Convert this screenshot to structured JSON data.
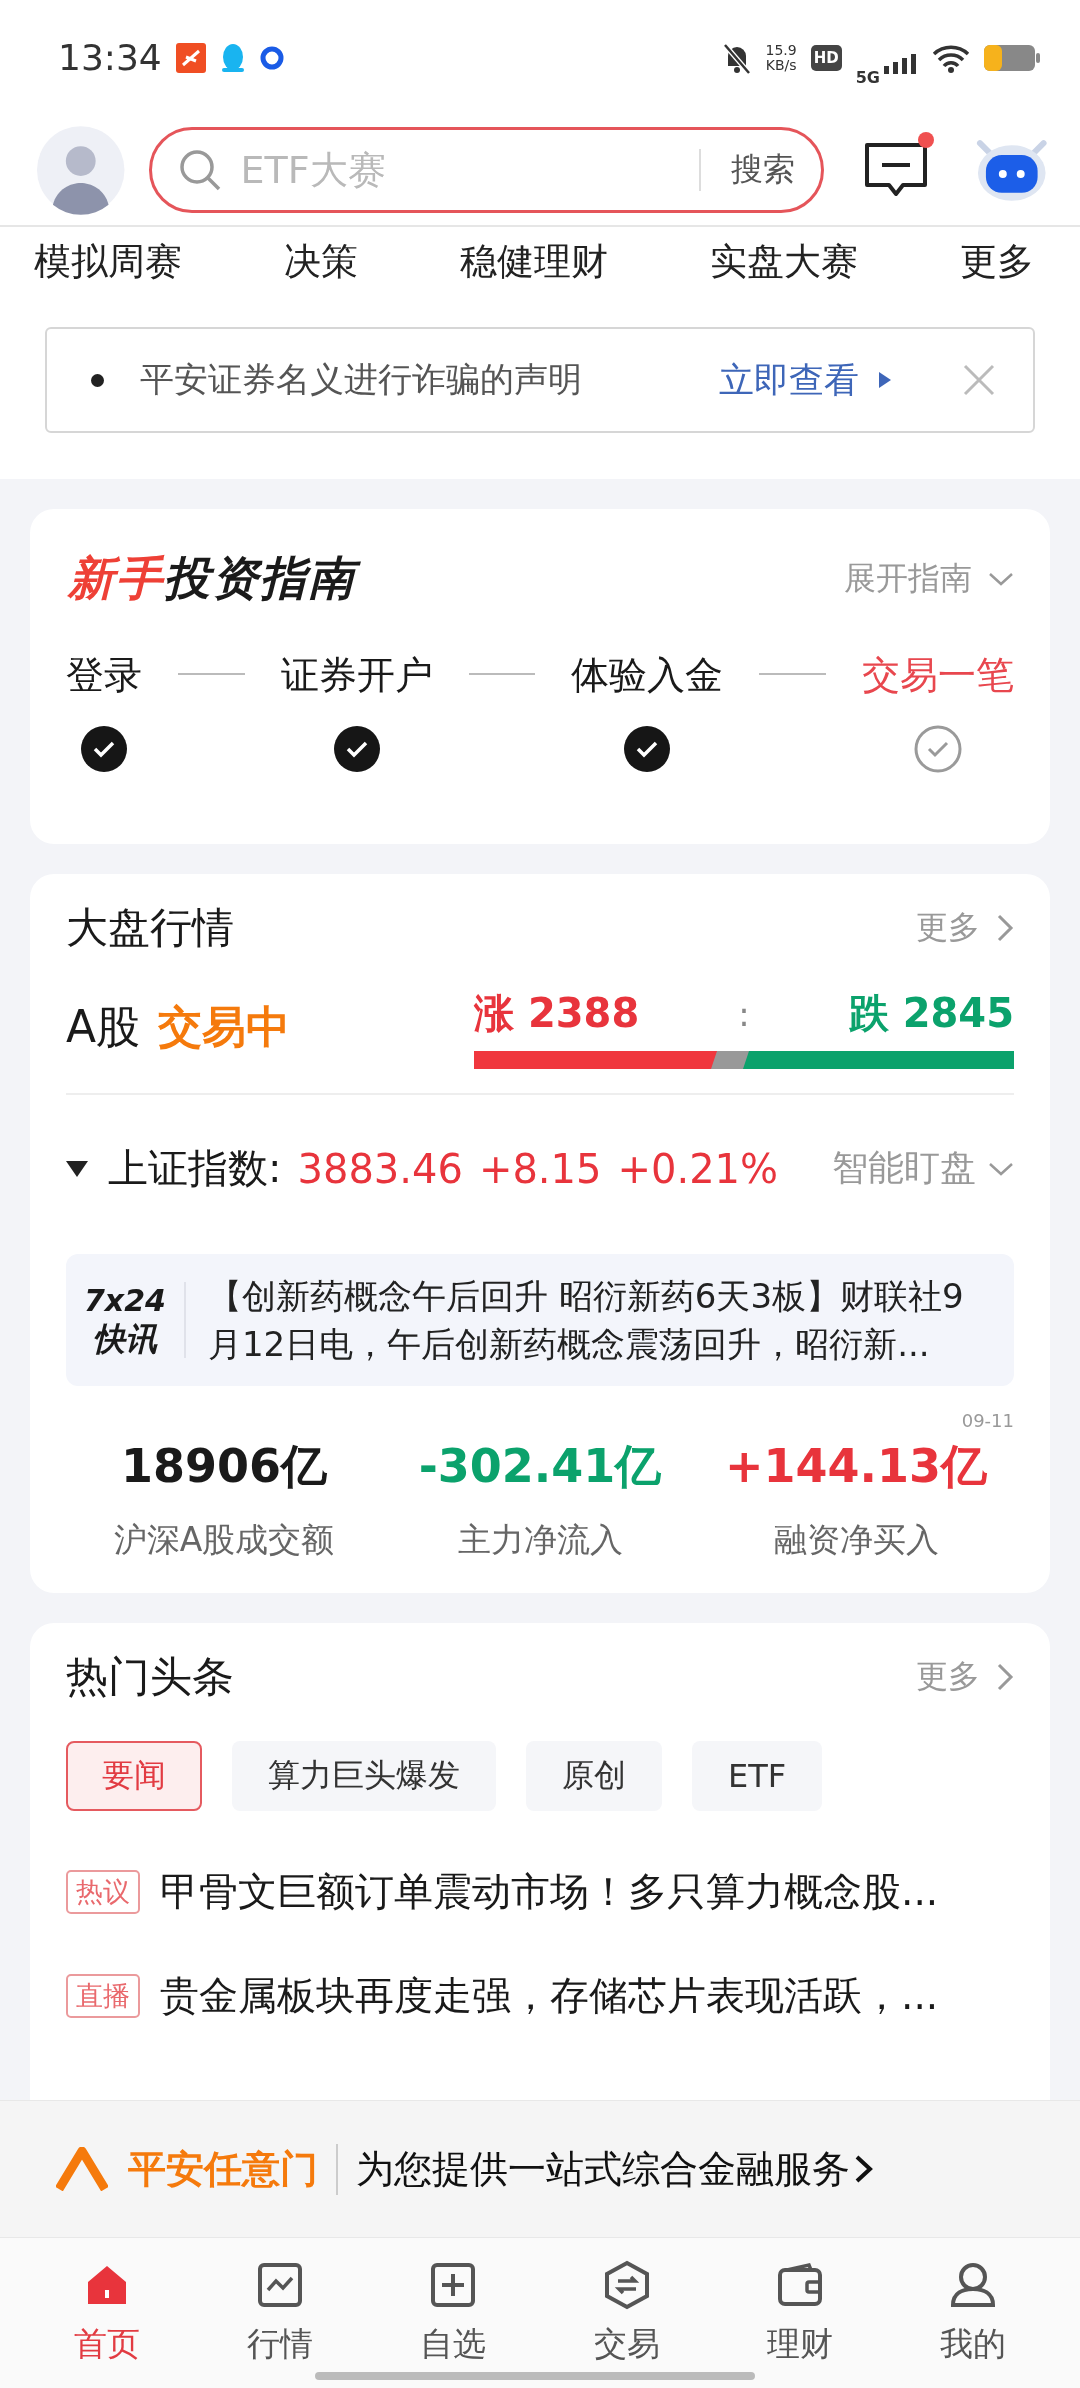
{
  "status_bar": {
    "time": "13:34",
    "net_speed": "15.9",
    "net_unit": "KB/s",
    "hd": "HD",
    "network": "5G"
  },
  "header": {
    "placeholder": "ETF大赛",
    "search_button": "搜索",
    "message_unread": true
  },
  "categories": [
    "模拟周赛",
    "决策",
    "稳健理财",
    "实盘大赛",
    "更多"
  ],
  "notice": {
    "text": "平安证券名义进行诈骗的声明",
    "link": "立即查看"
  },
  "guide": {
    "title_accent": "新手",
    "title": "投资指南",
    "expand": "展开指南",
    "steps": [
      {
        "label": "登录",
        "done": true,
        "current": false
      },
      {
        "label": "证券开户",
        "done": true,
        "current": false
      },
      {
        "label": "体验入金",
        "done": true,
        "current": false
      },
      {
        "label": "交易一笔",
        "done": false,
        "current": true
      }
    ]
  },
  "market": {
    "title": "大盘行情",
    "more": "更多",
    "market_label": "A股",
    "market_status": "交易中",
    "up_label": "涨",
    "up_count": "2388",
    "separator": ":",
    "down_label": "跌",
    "down_count": "2845",
    "level": 0.45,
    "index": {
      "name": "上证指数:",
      "value": "3883.46",
      "change": "+8.15",
      "percent": "+0.21%",
      "watch": "智能盯盘"
    },
    "flash": {
      "badge_top": "7x24",
      "badge_bottom": "快讯",
      "text": "【创新药概念午后回升 昭衍新药6天3板】财联社9月12日电，午后创新药概念震荡回升，昭衍新..."
    },
    "stats": [
      {
        "value": "18906亿",
        "label": "沪深A股成交额",
        "color": "#1a1a1a"
      },
      {
        "value": "-302.41亿",
        "label": "主力净流入",
        "color": "#0ba26c"
      },
      {
        "value": "+144.13亿",
        "label": "融资净买入",
        "color": "#e8343c",
        "date": "09-11"
      }
    ]
  },
  "news": {
    "title": "热门头条",
    "more": "更多",
    "filters": [
      {
        "label": "要闻",
        "selected": true
      },
      {
        "label": "算力巨头爆发",
        "selected": false
      },
      {
        "label": "原创",
        "selected": false
      },
      {
        "label": "ETF",
        "selected": false
      }
    ],
    "items": [
      {
        "tag": "热议",
        "title": "甲骨文巨额订单震动市场！多只算力概念股..."
      },
      {
        "tag": "直播",
        "title": "贵金属板块再度走强，存储芯片表现活跃，..."
      }
    ]
  },
  "promo": {
    "brand": "平安任意门",
    "text": "为您提供一站式综合金融服务"
  },
  "tabs": [
    {
      "label": "首页",
      "selected": true
    },
    {
      "label": "行情",
      "selected": false
    },
    {
      "label": "自选",
      "selected": false
    },
    {
      "label": "交易",
      "selected": false
    },
    {
      "label": "理财",
      "selected": false
    },
    {
      "label": "我的",
      "selected": false
    }
  ]
}
